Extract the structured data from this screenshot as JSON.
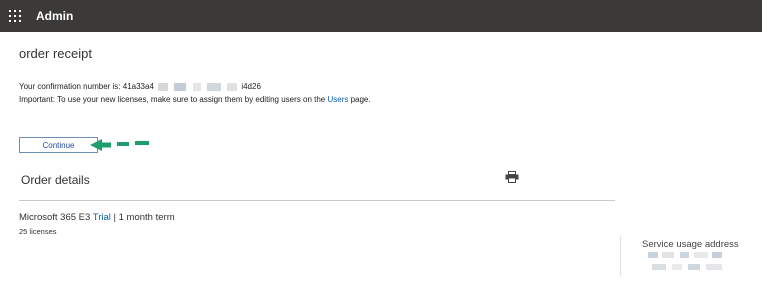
{
  "header": {
    "app_title": "Admin",
    "icon": "waffle-icon",
    "background": "#3b3a39"
  },
  "receipt": {
    "title": "order receipt",
    "confirmation_prefix": "Your confirmation number is: 41a33a4",
    "confirmation_suffix": "i4d26",
    "important_text": "Important: To use your new licenses, make sure to assign them by editing users on the ",
    "users_link": "Users",
    "important_tail": " page.",
    "continue_label": "Continue"
  },
  "order": {
    "title": "Order details",
    "print_icon": "printer-icon",
    "product_name": "Microsoft 365 E3 ",
    "product_trial": "Trial",
    "product_term": " | 1 month term",
    "licenses": "25 licenses"
  },
  "sidebar": {
    "service_heading": "Service usage address"
  },
  "colors": {
    "accent": "#0b5cad",
    "arrow": "#1e9e6a"
  }
}
